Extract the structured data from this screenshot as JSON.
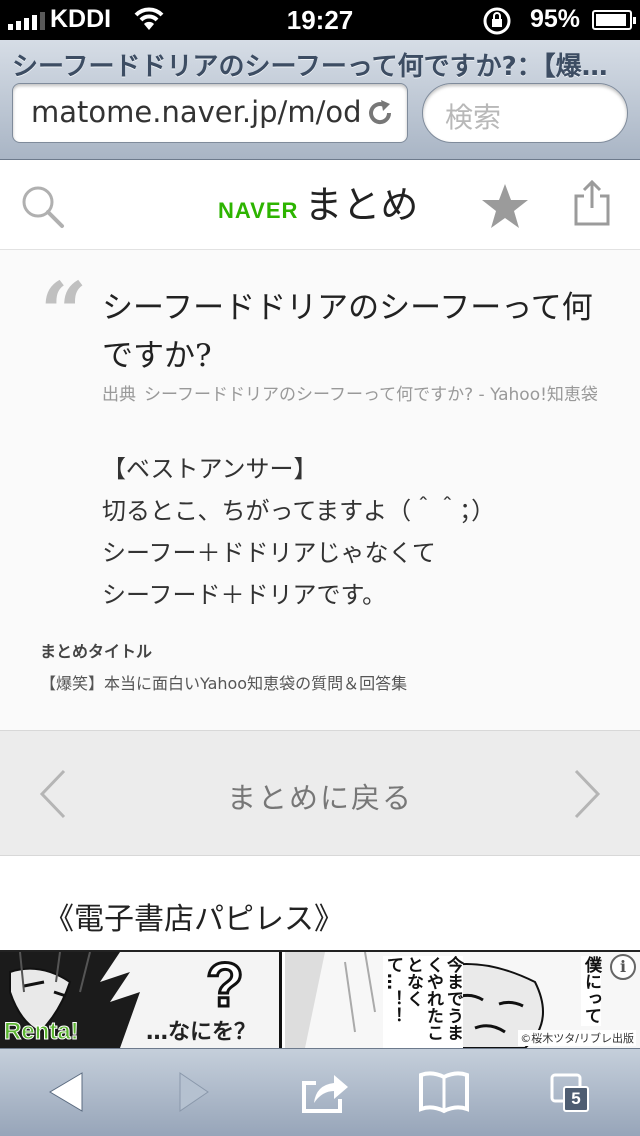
{
  "status_bar": {
    "carrier": "KDDI",
    "time": "19:27",
    "battery_percent": "95%",
    "battery_level": 0.95,
    "signal_bars": 4
  },
  "browser": {
    "page_title": "シーフードドリアのシーフーって何ですか?：【爆…",
    "url": "matome.naver.jp/m/odai",
    "search_placeholder": "検索"
  },
  "header": {
    "brand_naver": "NAVER",
    "brand_matome": "まとめ",
    "icons": [
      "search-icon",
      "star-icon",
      "share-icon"
    ]
  },
  "quote": {
    "title": "シーフードドリアのシーフーって何ですか?",
    "source_label": "出典",
    "source_text": "シーフードドリアのシーフーって何ですか? - Yahoo!知恵袋",
    "body_lines": [
      "【ベストアンサー】",
      "切るとこ、ちがってますよ（＾＾；）",
      "シーフー＋ドドリアじゃなくて",
      "シーフード＋ドリアです。"
    ],
    "matome_title_label": "まとめタイトル",
    "matome_title": "【爆笑】本当に面白いYahoo知恵袋の質問＆回答集"
  },
  "nav": {
    "back_label": "まとめに戻る"
  },
  "section": {
    "heading": "《電子書店パピレス》"
  },
  "ad": {
    "brand": "Renta!",
    "question_mark": "?",
    "question_text": "…なにを？",
    "speech_1": "今までうまくやれたことなくて…！！",
    "speech_2": "僕にって",
    "credit": "©桜木ツタ/リブレ出版"
  },
  "toolbar": {
    "tab_count": "5",
    "icons": [
      "back-arrow-icon",
      "forward-arrow-icon",
      "share-action-icon",
      "bookmarks-icon",
      "tabs-icon"
    ]
  },
  "colors": {
    "naver_green": "#2db400",
    "chrome_top": "#d6dde6",
    "chrome_bottom": "#a9b5c5"
  }
}
